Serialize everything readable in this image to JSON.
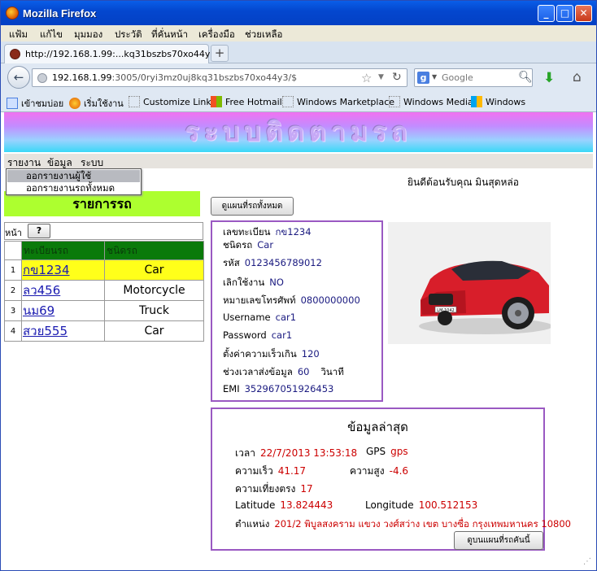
{
  "window": {
    "title": "Mozilla Firefox",
    "min": "_",
    "max": "□",
    "close": "✕"
  },
  "menubar": [
    "แฟ้ม",
    "แก้ไข",
    "มุมมอง",
    "ประวัติ",
    "ที่คั่นหน้า",
    "เครื่องมือ",
    "ช่วยเหลือ"
  ],
  "tab": {
    "title": "http://192.168.1.99:...kq31bszbs70xo44y3/$",
    "new_tab": "+"
  },
  "nav": {
    "url_host": "192.168.1.99",
    "url_rest": ":3005/0ryi3mz0uj8kq31bszbs70xo44y3/$",
    "search_placeholder": "Google"
  },
  "bookmarks": [
    "เข้าชมบ่อย",
    "เริ่มใช้งาน",
    "Customize Links",
    "Free Hotmail",
    "Windows Marketplace",
    "Windows Media",
    "Windows"
  ],
  "page": {
    "banner_title": "ระบบติดตามรถ",
    "app_menu": [
      "รายงาน",
      "ข้อมูล",
      "ระบบ"
    ],
    "dropdown": [
      "ออกรายงานผู้ใช้",
      "ออกรายงานรถทั้งหมด"
    ],
    "welcome": "ยินดีต้อนรับคุณ มินสุดหล่อ",
    "vehicle_list_title": "รายการรถ",
    "show_all_map_button": "ดูแผนที่รถทั้งหมด",
    "page_label": "หน้า",
    "help_button": "?",
    "table": {
      "headers": [
        "ทะเบียนรถ",
        "ชนิดรถ"
      ],
      "rows": [
        {
          "num": "1",
          "plate": "กข1234",
          "type": "Car"
        },
        {
          "num": "2",
          "plate": "ลว456",
          "type": "Motorcycle"
        },
        {
          "num": "3",
          "plate": "นม69",
          "type": "Truck"
        },
        {
          "num": "4",
          "plate": "สวย555",
          "type": "Car"
        }
      ]
    }
  },
  "detail": {
    "rows": [
      {
        "label": "เลขทะเบียน",
        "value": "กข1234"
      },
      {
        "label": "ชนิดรถ",
        "value": "Car"
      },
      {
        "label": "รหัส",
        "value": "0123456789012"
      },
      {
        "label": "เลิกใช้งาน",
        "value": "NO"
      },
      {
        "label": "หมายเลขโทรศัพท์",
        "value": "0800000000"
      },
      {
        "label": "Username",
        "value": "car1"
      },
      {
        "label": "Password",
        "value": "car1"
      },
      {
        "label": "ตั้งค่าความเร็วเกิน",
        "value": "120"
      },
      {
        "label": "ช่วงเวลาส่งข้อมูล",
        "value": "60",
        "unit": "วินาที"
      },
      {
        "label": "EMI",
        "value": "352967051926453"
      }
    ],
    "image_plate": "LM·1042"
  },
  "latest": {
    "title": "ข้อมูลล่าสุด",
    "time_label": "เวลา",
    "time_value": "22/7/2013 13:53:18",
    "gps_label": "GPS",
    "gps_value": "gps",
    "speed_label": "ความเร็ว",
    "speed_value": "41.17",
    "altitude_label": "ความสูง",
    "altitude_value": "-4.6",
    "accuracy_label": "ความเที่ยงตรง",
    "accuracy_value": "17",
    "lat_label": "Latitude",
    "lat_value": "13.824443",
    "lng_label": "Longitude",
    "lng_value": "100.512153",
    "pos_label": "ตำแหน่ง",
    "pos_value": "201/2 พิบูลสงคราม แขวง วงศ์สว่าง เขต บางซื่อ กรุงเทพมหานคร 10800",
    "map_button": "ดูบนแผนที่รถคันนี้"
  },
  "colors": {
    "title_bar": "#0447cf",
    "list_header": "#adff2f",
    "table_header": "#0a7a0a",
    "selected_row": "#ffff1a",
    "panel_border": "#9a59c2",
    "value_red": "#cc0000"
  }
}
